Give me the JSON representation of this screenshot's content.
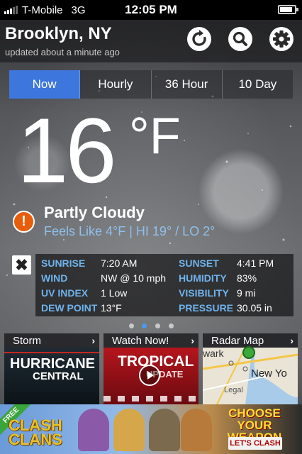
{
  "status_bar": {
    "carrier": "T-Mobile",
    "network": "3G",
    "time": "12:05 PM",
    "battery_level": 0.85
  },
  "header": {
    "city": "Brooklyn, NY",
    "updated": "updated about a minute ago",
    "refresh_icon": "refresh-icon",
    "search_icon": "search-icon",
    "settings_icon": "gear-icon"
  },
  "tabs": [
    {
      "label": "Now",
      "active": true
    },
    {
      "label": "Hourly",
      "active": false
    },
    {
      "label": "36 Hour",
      "active": false
    },
    {
      "label": "10 Day",
      "active": false
    }
  ],
  "current": {
    "temperature": "16",
    "unit": "°F",
    "condition": "Partly Cloudy",
    "feels_like": "Feels Like 4°F | HI 19° / LO 2°",
    "alert_icon": "!"
  },
  "details": {
    "close_icon": "✖",
    "rows": [
      {
        "l1": "SUNRISE",
        "v1": "7:20 AM",
        "l2": "SUNSET",
        "v2": "4:41 PM"
      },
      {
        "l1": "WIND",
        "v1": "NW @ 10 mph",
        "l2": "HUMIDITY",
        "v2": "83%"
      },
      {
        "l1": "UV INDEX",
        "v1": "1 Low",
        "l2": "VISIBILITY",
        "v2": "9 mi"
      },
      {
        "l1": "DEW POINT",
        "v1": "13°F",
        "l2": "PRESSURE",
        "v2": "30.05 in"
      }
    ]
  },
  "pager": {
    "active_index": 1,
    "count": 4
  },
  "promos": [
    {
      "title": "Storm",
      "line1": "HURRICANE",
      "line2": "CENTRAL"
    },
    {
      "title": "Watch Now!",
      "line1": "TROPICAL",
      "line2": "UPDATE"
    },
    {
      "title": "Radar Map",
      "line1": "wark",
      "line2": "New Yo",
      "line3": "Legal"
    }
  ],
  "ad": {
    "badge": "FREE",
    "game": "CLASH\nCLANS",
    "headline": "CHOOSE YOUR WEAPON",
    "cta": "LET'S CLASH"
  },
  "colors": {
    "accent": "#3d76dc",
    "label_blue": "#6fb3ec",
    "alert": "#e85d0c"
  }
}
